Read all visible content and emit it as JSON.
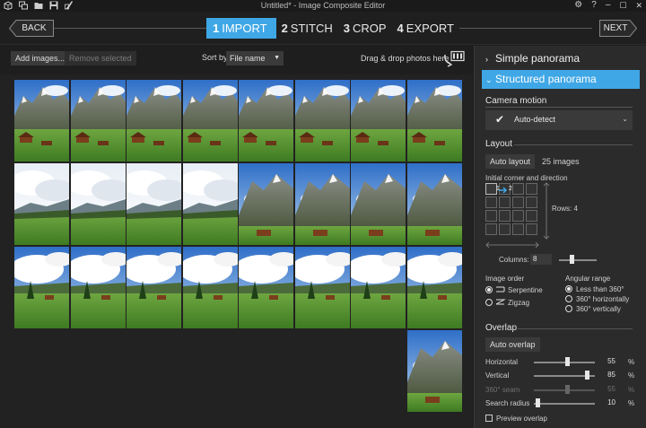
{
  "window": {
    "title": "Untitled* - Image Composite Editor",
    "settings_glyph": "⚙",
    "help_glyph": "?",
    "minimize_glyph": "–",
    "maximize_glyph": "☐",
    "close_glyph": "✕"
  },
  "quick_icons": [
    "new-project-icon",
    "new-panorama-icon",
    "open-icon",
    "save-icon",
    "export-icon"
  ],
  "nav": {
    "back_label": "BACK",
    "next_label": "NEXT",
    "steps": [
      {
        "num": "1",
        "label": "IMPORT"
      },
      {
        "num": "2",
        "label": "STITCH"
      },
      {
        "num": "3",
        "label": "CROP"
      },
      {
        "num": "4",
        "label": "EXPORT"
      }
    ],
    "active_step": 0
  },
  "toolbar": {
    "add_images_label": "Add images...",
    "remove_selected_label": "Remove selected",
    "sort_by_label": "Sort by",
    "sort_value": "File name",
    "drag_drop_label": "Drag & drop photos here"
  },
  "images": {
    "count": 25,
    "rows": 4,
    "columns": 8
  },
  "panel": {
    "simple_panorama_label": "Simple panorama",
    "structured_panorama_label": "Structured panorama",
    "camera_motion": {
      "title": "Camera motion",
      "value": "Auto-detect"
    },
    "layout": {
      "title": "Layout",
      "auto_layout_label": "Auto layout",
      "images_count_label": "25 images",
      "initial_corner_label": "Initial corner and direction",
      "corner_first": "1",
      "corner_second": "2",
      "rows_label": "Rows: 4",
      "columns_label": "Columns:",
      "columns_value": "8"
    },
    "image_order": {
      "title": "Image order",
      "options": [
        "Serpentine",
        "Zigzag"
      ],
      "selected": 0
    },
    "angular_range": {
      "title": "Angular range",
      "options": [
        "Less than 360°",
        "360° horizontally",
        "360° vertically"
      ],
      "selected": 0
    },
    "overlap": {
      "title": "Overlap",
      "auto_overlap_label": "Auto overlap",
      "horizontal_label": "Horizontal",
      "horizontal_value": "55",
      "vertical_label": "Vertical",
      "vertical_value": "85",
      "seam_label": "360° seam",
      "seam_value": "55",
      "search_radius_label": "Search radius",
      "search_radius_value": "10",
      "percent_sign": "%",
      "preview_overlap_label": "Preview overlap"
    }
  },
  "colors": {
    "accent": "#3fa7e6",
    "background": "#1e1e1e",
    "panel": "#2b2b2b"
  }
}
